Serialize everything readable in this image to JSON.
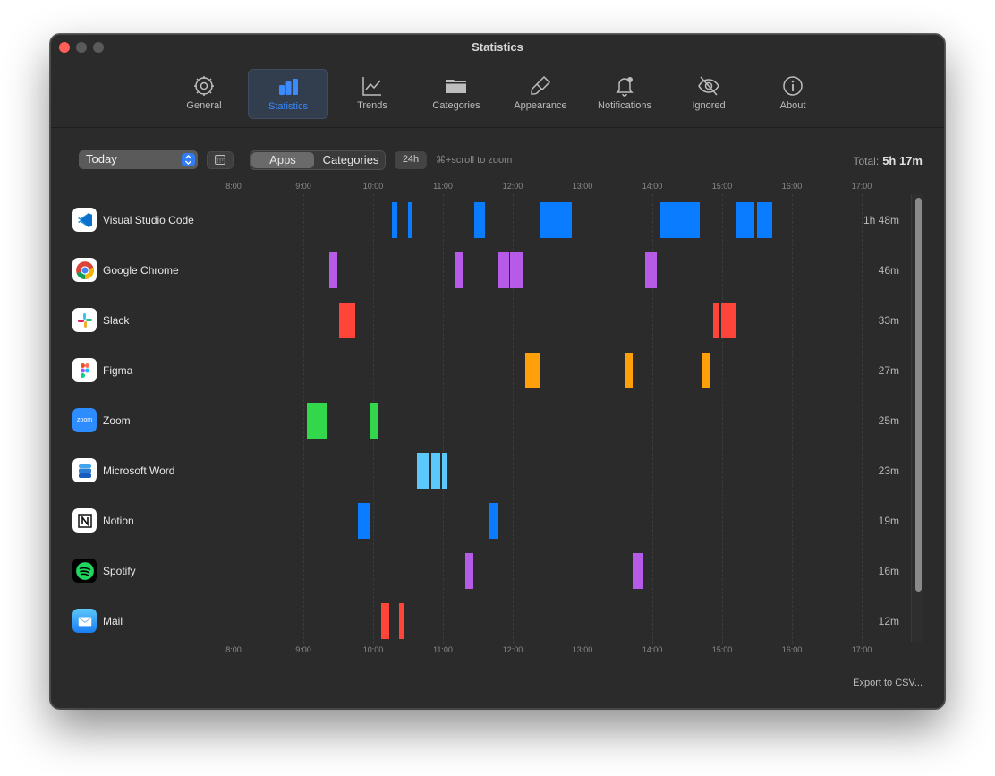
{
  "window": {
    "title": "Statistics"
  },
  "toolbar": {
    "tabs": [
      {
        "label": "General",
        "icon": "gear-icon"
      },
      {
        "label": "Statistics",
        "icon": "bar-chart-icon",
        "active": true
      },
      {
        "label": "Trends",
        "icon": "line-chart-icon"
      },
      {
        "label": "Categories",
        "icon": "folder-icon"
      },
      {
        "label": "Appearance",
        "icon": "paintbrush-icon"
      },
      {
        "label": "Notifications",
        "icon": "bell-icon"
      },
      {
        "label": "Ignored",
        "icon": "eye-slash-icon"
      },
      {
        "label": "About",
        "icon": "info-icon"
      }
    ]
  },
  "controls": {
    "period": "Today",
    "segment": {
      "apps": "Apps",
      "categories": "Categories",
      "selected": "Apps"
    },
    "range_button": "24h",
    "zoom_hint": "⌘+scroll to zoom",
    "total_label": "Total:",
    "total_value": "5h 17m"
  },
  "axis": {
    "ticks": [
      "8:00",
      "9:00",
      "10:00",
      "11:00",
      "12:00",
      "13:00",
      "14:00",
      "15:00",
      "16:00",
      "17:00"
    ]
  },
  "colors": {
    "blue": "#0a7cff",
    "purple": "#b65ae8",
    "red": "#ff453a",
    "orange": "#ff9f0a",
    "green": "#32d74b",
    "lightblue": "#5ac8fa",
    "accent": "#3b8bff"
  },
  "rows": [
    {
      "name": "Visual Studio Code",
      "duration": "1h 48m",
      "icon": "vscode-icon",
      "color": "#0a7cff",
      "sessions": [
        [
          "10:16",
          "10:21"
        ],
        [
          "10:30",
          "10:34"
        ],
        [
          "11:27",
          "11:36"
        ],
        [
          "12:24",
          "12:51"
        ],
        [
          "14:07",
          "14:41"
        ],
        [
          "15:12",
          "15:28"
        ],
        [
          "15:30",
          "15:43"
        ]
      ]
    },
    {
      "name": "Google Chrome",
      "duration": "46m",
      "icon": "chrome-icon",
      "color": "#b65ae8",
      "sessions": [
        [
          "9:22",
          "9:29"
        ],
        [
          "11:11",
          "11:18"
        ],
        [
          "11:48",
          "11:57"
        ],
        [
          "11:58",
          "12:09"
        ],
        [
          "13:54",
          "14:04"
        ]
      ]
    },
    {
      "name": "Slack",
      "duration": "33m",
      "icon": "slack-icon",
      "color": "#ff453a",
      "sessions": [
        [
          "9:31",
          "9:45"
        ],
        [
          "14:52",
          "14:58"
        ],
        [
          "14:59",
          "15:12"
        ]
      ]
    },
    {
      "name": "Figma",
      "duration": "27m",
      "icon": "figma-icon",
      "color": "#ff9f0a",
      "sessions": [
        [
          "12:11",
          "12:23"
        ],
        [
          "13:37",
          "13:43"
        ],
        [
          "14:42",
          "14:49"
        ]
      ]
    },
    {
      "name": "Zoom",
      "duration": "25m",
      "icon": "zoom-icon",
      "color": "#32d74b",
      "sessions": [
        [
          "9:03",
          "9:20"
        ],
        [
          "9:57",
          "10:04"
        ]
      ]
    },
    {
      "name": "Microsoft Word",
      "duration": "23m",
      "icon": "word-icon",
      "color": "#5ac8fa",
      "sessions": [
        [
          "10:38",
          "10:48"
        ],
        [
          "10:50",
          "10:58"
        ],
        [
          "10:59",
          "11:04"
        ]
      ]
    },
    {
      "name": "Notion",
      "duration": "19m",
      "icon": "notion-icon",
      "color": "#0a7cff",
      "sessions": [
        [
          "9:47",
          "9:57"
        ],
        [
          "11:39",
          "11:48"
        ]
      ]
    },
    {
      "name": "Spotify",
      "duration": "16m",
      "icon": "spotify-icon",
      "color": "#b65ae8",
      "sessions": [
        [
          "11:19",
          "11:26"
        ],
        [
          "13:43",
          "13:52"
        ]
      ]
    },
    {
      "name": "Mail",
      "duration": "12m",
      "icon": "mail-icon",
      "color": "#ff453a",
      "sessions": [
        [
          "10:07",
          "10:14"
        ],
        [
          "10:22",
          "10:27"
        ]
      ]
    }
  ],
  "footer": {
    "export_label": "Export to CSV..."
  }
}
